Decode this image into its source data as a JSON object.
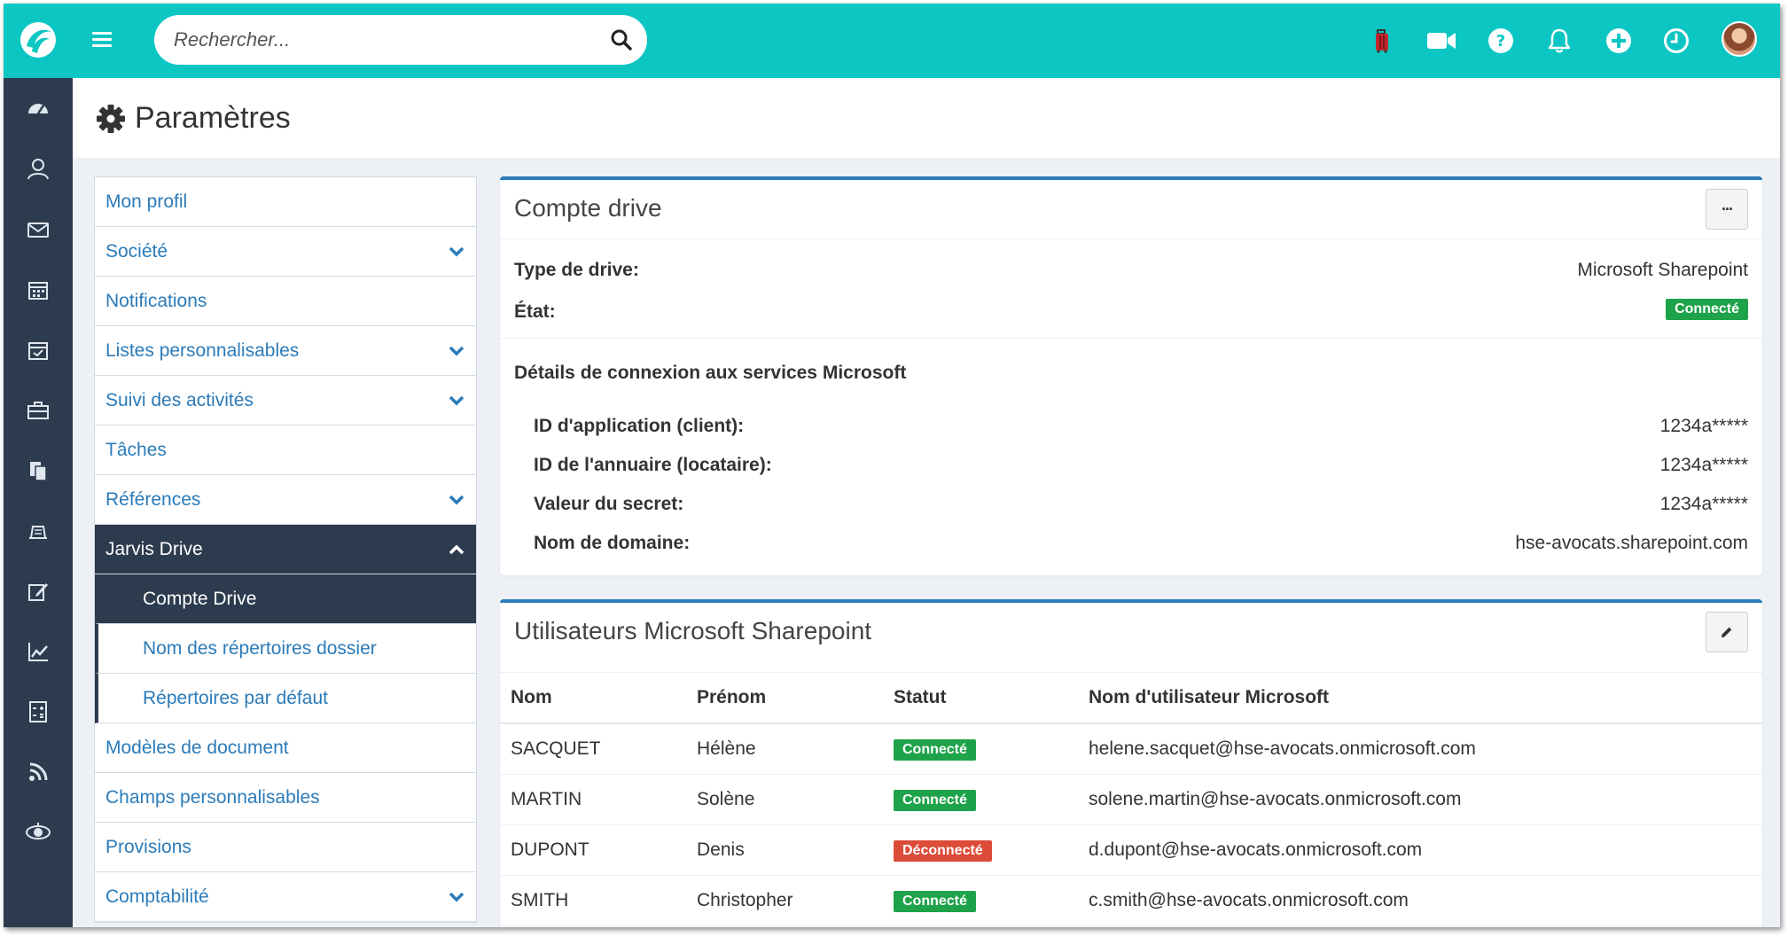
{
  "search": {
    "placeholder": "Rechercher..."
  },
  "header": {
    "icons": [
      "logo-icon",
      "menu-icon",
      "search-icon",
      "luggage-icon",
      "video-camera-icon",
      "help-icon",
      "bell-icon",
      "plus-circle-icon",
      "clock-icon",
      "avatar"
    ]
  },
  "sidebar_icons": [
    "dashboard-icon",
    "contacts-icon",
    "mail-icon",
    "calendar-icon",
    "tasks-calendar-icon",
    "briefcase-icon",
    "documents-icon",
    "invoice-icon",
    "edit-icon",
    "chart-icon",
    "calculator-icon",
    "rss-icon",
    "jarvis-icon"
  ],
  "page": {
    "title": "Paramètres"
  },
  "settings_menu": {
    "items": [
      {
        "label": "Mon profil"
      },
      {
        "label": "Société"
      },
      {
        "label": "Notifications"
      },
      {
        "label": "Listes personnalisables"
      },
      {
        "label": "Suivi des activités"
      },
      {
        "label": "Tâches"
      },
      {
        "label": "Références"
      },
      {
        "label": "Jarvis Drive"
      },
      {
        "label": "Compte Drive"
      },
      {
        "label": "Nom des répertoires dossier"
      },
      {
        "label": "Répertoires par défaut"
      },
      {
        "label": "Modèles de document"
      },
      {
        "label": "Champs personnalisables"
      },
      {
        "label": "Provisions"
      },
      {
        "label": "Comptabilité"
      }
    ]
  },
  "drive_account": {
    "title": "Compte drive",
    "more_button": "···",
    "drive_type_label": "Type de drive:",
    "drive_type_value": "Microsoft Sharepoint",
    "state_label": "État:",
    "state_value": "Connecté",
    "ms_section_title": "Détails de connexion aux services Microsoft",
    "app_id_label": "ID d'application (client):",
    "app_id_value": "1234a*****",
    "tenant_id_label": "ID de l'annuaire (locataire):",
    "tenant_id_value": "1234a*****",
    "secret_label": "Valeur du secret:",
    "secret_value": "1234a*****",
    "domain_label": "Nom de domaine:",
    "domain_value": "hse-avocats.sharepoint.com"
  },
  "sharepoint_users": {
    "title": "Utilisateurs Microsoft Sharepoint",
    "columns": [
      "Nom",
      "Prénom",
      "Statut",
      "Nom d'utilisateur Microsoft"
    ],
    "rows": [
      {
        "nom": "SACQUET",
        "prenom": "Hélène",
        "statut": "Connecté",
        "statut_color": "#1ea34a",
        "email": "helene.sacquet@hse-avocats.onmicrosoft.com"
      },
      {
        "nom": "MARTIN",
        "prenom": "Solène",
        "statut": "Connecté",
        "statut_color": "#1ea34a",
        "email": "solene.martin@hse-avocats.onmicrosoft.com"
      },
      {
        "nom": "DUPONT",
        "prenom": "Denis",
        "statut": "Déconnecté",
        "statut_color": "#dd4b39",
        "email": "d.dupont@hse-avocats.onmicrosoft.com"
      },
      {
        "nom": "SMITH",
        "prenom": "Christopher",
        "statut": "Connecté",
        "statut_color": "#1ea34a",
        "email": "c.smith@hse-avocats.onmicrosoft.com"
      }
    ]
  },
  "colors": {
    "topbar": "#0bc6c3",
    "sidebar": "#2d3b4e",
    "link": "#2b7bb9",
    "success": "#1ea34a",
    "danger": "#dd4b39"
  }
}
